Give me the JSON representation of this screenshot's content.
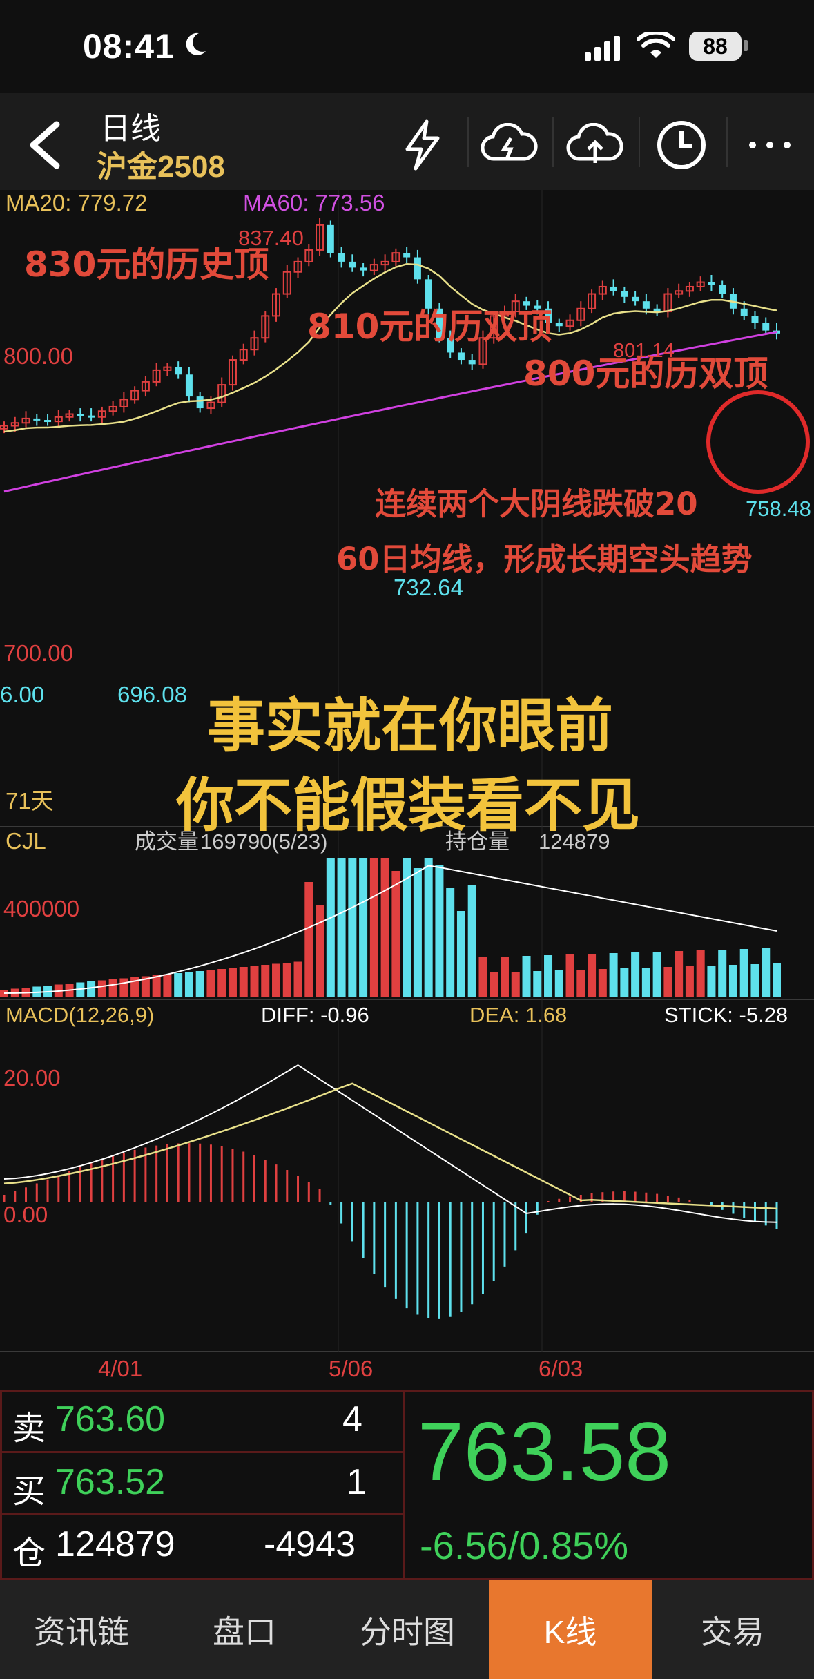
{
  "status": {
    "time": "08:41",
    "battery": "88"
  },
  "header": {
    "title": "日线",
    "subtitle": "沪金2508"
  },
  "ma": {
    "ma20": "MA20: 779.72",
    "ma60": "MA60: 773.56"
  },
  "price_labels": {
    "high": "837.40",
    "p800": "800.00",
    "p801": "801.14",
    "p700": "700.00",
    "p696": "696.08",
    "p732": "732.64",
    "p758": "758.48",
    "p6": "6.00"
  },
  "annotations": {
    "a1": "830元的历史顶",
    "a2": "810元的历双顶",
    "a3": "800元的历双顶",
    "a4": "连续两个大阴线跌破20",
    "a5": "60日均线，形成长期空头趋势",
    "big1": "事实就在你眼前",
    "big2": "你不能假装看不见"
  },
  "days_label": "71天",
  "volume": {
    "title": "CJL",
    "legend_left": "成交量",
    "value_left": "169790(5/23)",
    "legend_right": "持仓量",
    "value_right": "124879",
    "tick": "400000"
  },
  "macd": {
    "title": "MACD(12,26,9)",
    "diff": "DIFF: -0.96",
    "dea": "DEA: 1.68",
    "stick": "STICK: -5.28",
    "tick20": "20.00",
    "tick0": "0.00"
  },
  "dates": [
    "4/01",
    "5/06",
    "6/03"
  ],
  "quote": {
    "sell_label": "卖",
    "sell_price": "763.60",
    "sell_qty": "4",
    "buy_label": "买",
    "buy_price": "763.52",
    "buy_qty": "1",
    "pos_label": "仓",
    "pos_value": "124879",
    "pos_change": "-4943",
    "last": "763.58",
    "change": "-6.56/0.85%"
  },
  "tabs": [
    {
      "label": "资讯链"
    },
    {
      "label": "盘口"
    },
    {
      "label": "分时图"
    },
    {
      "label": "K线"
    },
    {
      "label": "交易"
    }
  ],
  "colors": {
    "up": "#e04040",
    "down": "#5ee0ec",
    "ma20": "#e8e08a",
    "ma60": "#d040e0",
    "annotation": "#e24a3a",
    "big_text": "#f2c33c",
    "accent": "#e8772e",
    "green": "#3fd15a"
  }
}
